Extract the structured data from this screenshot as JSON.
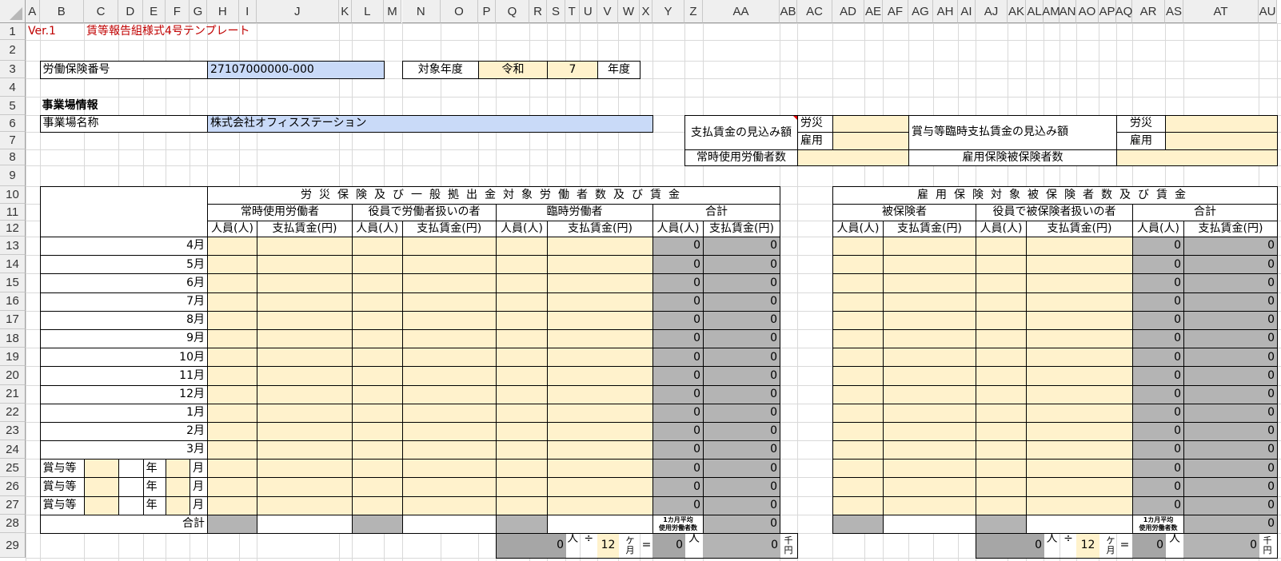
{
  "sheet": {
    "columns": [
      "A",
      "B",
      "C",
      "D",
      "E",
      "F",
      "G",
      "H",
      "I",
      "J",
      "K",
      "L",
      "M",
      "N",
      "O",
      "P",
      "Q",
      "R",
      "S",
      "T",
      "U",
      "V",
      "W",
      "X",
      "Y",
      "Z",
      "AA",
      "AB",
      "AC",
      "AD",
      "AE",
      "AF",
      "AG",
      "AH",
      "AI",
      "AJ",
      "AK",
      "AL",
      "AM",
      "AN",
      "AO",
      "AP",
      "AQ",
      "AR",
      "AS",
      "AT",
      "AU"
    ],
    "rows": [
      "1",
      "2",
      "3",
      "4",
      "5",
      "6",
      "7",
      "8",
      "9",
      "10",
      "11",
      "12",
      "13",
      "14",
      "15",
      "16",
      "17",
      "18",
      "19",
      "20",
      "21",
      "22",
      "23",
      "24",
      "25",
      "26",
      "27",
      "28",
      "29"
    ]
  },
  "header": {
    "version": "Ver.1",
    "title": "賃等報告組様式4号テンプレート"
  },
  "insurance": {
    "label": "労働保険番号",
    "value": "27107000000-000"
  },
  "year": {
    "label": "対象年度",
    "era": "令和",
    "value": "7",
    "suffix": "年度"
  },
  "site": {
    "section": "事業場情報",
    "name_label": "事業場名称",
    "name_value": "株式会社オフィスステーション"
  },
  "estimate": {
    "label": "支払賃金の見込み額",
    "rosai": "労災",
    "koyo": "雇用",
    "workers_label": "常時使用労働者数"
  },
  "bonus_estimate": {
    "label": "賞与等臨時支払賃金の見込み額",
    "rosai": "労災",
    "koyo": "雇用",
    "insured_label": "雇用保険被保険者数"
  },
  "months": [
    "4月",
    "5月",
    "6月",
    "7月",
    "8月",
    "9月",
    "10月",
    "11月",
    "12月",
    "1月",
    "2月",
    "3月"
  ],
  "bonus_rows": {
    "label": "賞与等",
    "year": "年",
    "month": "月"
  },
  "total_label": "合計",
  "people_label": "人員(人)",
  "wage_label": "支払賃金(円)",
  "left": {
    "title": "労災保険及び一般拠出金対象労働者数及び賃金",
    "groups": [
      "常時使用労働者",
      "役員で労働者扱いの者",
      "臨時労働者",
      "合計"
    ],
    "totals": [
      {
        "people": "0",
        "wage": "0"
      },
      {
        "people": "0",
        "wage": "0"
      },
      {
        "people": "0",
        "wage": "0"
      },
      {
        "people": "0",
        "wage": "0"
      },
      {
        "people": "0",
        "wage": "0"
      },
      {
        "people": "0",
        "wage": "0"
      },
      {
        "people": "0",
        "wage": "0"
      },
      {
        "people": "0",
        "wage": "0"
      },
      {
        "people": "0",
        "wage": "0"
      },
      {
        "people": "0",
        "wage": "0"
      },
      {
        "people": "0",
        "wage": "0"
      },
      {
        "people": "0",
        "wage": "0"
      },
      {
        "people": "0",
        "wage": "0"
      },
      {
        "people": "0",
        "wage": "0"
      },
      {
        "people": "0",
        "wage": "0"
      }
    ],
    "grand_wage": "0",
    "avg_label_1": "1カ月平均",
    "avg_label_2": "使用労働者数",
    "summary": {
      "total_people": "0",
      "people_unit": "人",
      "divide": "÷",
      "months": "12",
      "months_unit": "ケ月",
      "equals": "=",
      "avg": "0",
      "avg_unit": "人",
      "wage_total": "0",
      "wage_unit": "千円"
    }
  },
  "right": {
    "title": "雇用保険対象被保険者数及び賃金",
    "groups": [
      "被保険者",
      "役員で被保険者扱いの者",
      "合計"
    ],
    "totals": [
      {
        "people": "0",
        "wage": "0"
      },
      {
        "people": "0",
        "wage": "0"
      },
      {
        "people": "0",
        "wage": "0"
      },
      {
        "people": "0",
        "wage": "0"
      },
      {
        "people": "0",
        "wage": "0"
      },
      {
        "people": "0",
        "wage": "0"
      },
      {
        "people": "0",
        "wage": "0"
      },
      {
        "people": "0",
        "wage": "0"
      },
      {
        "people": "0",
        "wage": "0"
      },
      {
        "people": "0",
        "wage": "0"
      },
      {
        "people": "0",
        "wage": "0"
      },
      {
        "people": "0",
        "wage": "0"
      },
      {
        "people": "0",
        "wage": "0"
      },
      {
        "people": "0",
        "wage": "0"
      },
      {
        "people": "0",
        "wage": "0"
      }
    ],
    "grand_wage": "0",
    "avg_label_1": "1カ月平均",
    "avg_label_2": "使用労働者数",
    "summary": {
      "total_people": "0",
      "people_unit": "人",
      "divide": "÷",
      "months": "12",
      "months_unit": "ケ月",
      "equals": "=",
      "avg": "0",
      "avg_unit": "人",
      "wage_total": "0",
      "wage_unit": "千円"
    }
  },
  "colors": {
    "input": "#fff2cc",
    "id_field": "#c9daf8",
    "formula": "#b4b4b4",
    "accent": "#c00000"
  }
}
